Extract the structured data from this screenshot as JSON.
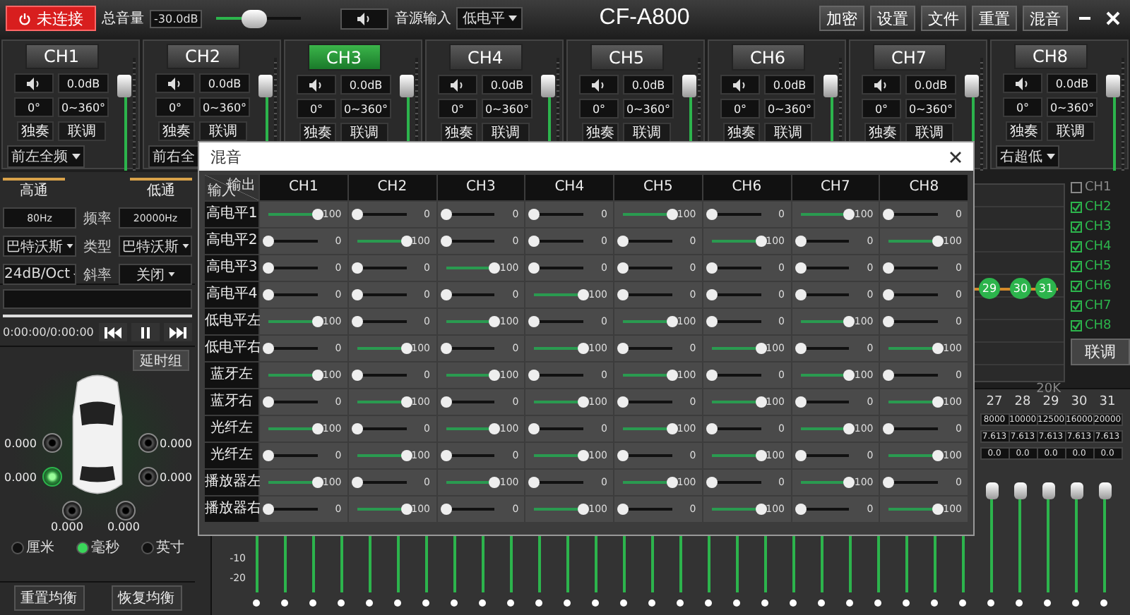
{
  "title_bar": {
    "connect_button": "未连接",
    "volume_label": "总音量",
    "volume_reading": "-30.0dB",
    "volume": {
      "level": 0.45
    },
    "source_label": "音源输入",
    "source_select": "低电平",
    "title": "CF-A800",
    "buttons": [
      "加密",
      "设置",
      "文件",
      "重置",
      "混音"
    ]
  },
  "channels": [
    {
      "name": "CH1",
      "selected": false,
      "gain": "0.0dB",
      "phase": "0°",
      "phase_range": "0~360°",
      "solo": "独奏",
      "link": "联调",
      "output": "前左全频",
      "caret": true,
      "level": 0.85
    },
    {
      "name": "CH2",
      "selected": false,
      "gain": "0.0dB",
      "phase": "0°",
      "phase_range": "0~360°",
      "solo": "独奏",
      "link": "联调",
      "output": "前右全",
      "caret": false,
      "level": 0.85
    },
    {
      "name": "CH3",
      "selected": true,
      "gain": "0.0dB",
      "phase": "0°",
      "phase_range": "0~360°",
      "solo": "独奏",
      "link": "联调",
      "level": 0.85
    },
    {
      "name": "CH4",
      "selected": false,
      "gain": "0.0dB",
      "phase": "0°",
      "phase_range": "0~360°",
      "solo": "独奏",
      "link": "联调",
      "level": 0.85
    },
    {
      "name": "CH5",
      "selected": false,
      "gain": "0.0dB",
      "phase": "0°",
      "phase_range": "0~360°",
      "solo": "独奏",
      "link": "联调",
      "level": 0.85
    },
    {
      "name": "CH6",
      "selected": false,
      "gain": "0.0dB",
      "phase": "0°",
      "phase_range": "0~360°",
      "solo": "独奏",
      "link": "联调",
      "level": 0.85
    },
    {
      "name": "CH7",
      "selected": false,
      "gain": "0.0dB",
      "phase": "0°",
      "phase_range": "0~360°",
      "solo": "独奏",
      "link": "联调",
      "level": 0.85
    },
    {
      "name": "CH8",
      "selected": false,
      "gain": "0.0dB",
      "phase": "0°",
      "phase_range": "0~360°",
      "solo": "独奏",
      "link": "联调",
      "output": "右超低",
      "caret": true,
      "level": 0.85
    }
  ],
  "filter": {
    "highpass_label": "高通",
    "lowpass_label": "低通",
    "rows": [
      {
        "kind": "value",
        "label": "频率",
        "highpass": "80Hz",
        "lowpass": "20000Hz"
      },
      {
        "kind": "select",
        "label": "类型",
        "highpass": "巴特沃斯",
        "lowpass": "巴特沃斯"
      },
      {
        "kind": "select",
        "label": "斜率",
        "highpass": "24dB/Oct",
        "lowpass": "关闭"
      }
    ]
  },
  "player": {
    "time": "0:00:00/0:00:00"
  },
  "delay": {
    "group_button": "延时组",
    "speakers": [
      {
        "value": "0.000",
        "selected": false
      },
      {
        "value": "0.000",
        "selected": false
      },
      {
        "value": "0.000",
        "selected": true
      },
      {
        "value": "0.000",
        "selected": false
      },
      {
        "value": "0.000",
        "selected": false
      },
      {
        "value": "0.000",
        "selected": false
      }
    ],
    "units": [
      {
        "label": "厘米",
        "selected": false
      },
      {
        "label": "毫秒",
        "selected": true
      },
      {
        "label": "英寸",
        "selected": false
      }
    ]
  },
  "eq_buttons": [
    "重置均衡",
    "恢复均衡"
  ],
  "eq": {
    "nodes": [
      "29",
      "30",
      "31"
    ],
    "axis_label": "20K",
    "channel_checks": [
      {
        "label": "CH1",
        "checked": false
      },
      {
        "label": "CH2",
        "checked": true
      },
      {
        "label": "CH3",
        "checked": true
      },
      {
        "label": "CH4",
        "checked": true
      },
      {
        "label": "CH5",
        "checked": true
      },
      {
        "label": "CH6",
        "checked": true
      },
      {
        "label": "CH7",
        "checked": true
      },
      {
        "label": "CH8",
        "checked": true
      }
    ],
    "link_button": "联调",
    "scale": [
      "-10",
      "-20"
    ],
    "bands": [
      {
        "number": "27",
        "freq": "8000",
        "q": "7.613",
        "gain": "0.0"
      },
      {
        "number": "28",
        "freq": "10000",
        "q": "7.613",
        "gain": "0.0"
      },
      {
        "number": "29",
        "freq": "12500",
        "q": "7.613",
        "gain": "0.0"
      },
      {
        "number": "30",
        "freq": "16000",
        "q": "7.613",
        "gain": "0.0"
      },
      {
        "number": "31",
        "freq": "20000",
        "q": "7.613",
        "gain": "0.0"
      }
    ]
  },
  "mixer": {
    "title": "混音",
    "input_label": "输入",
    "output_label": "输出",
    "columns": [
      "CH1",
      "CH2",
      "CH3",
      "CH4",
      "CH5",
      "CH6",
      "CH7",
      "CH8"
    ],
    "rows": [
      {
        "label": "高电平1",
        "cells": [
          {
            "level": 1,
            "value": "100"
          },
          {
            "level": 0,
            "value": "0"
          },
          {
            "level": 0,
            "value": "0"
          },
          {
            "level": 0,
            "value": "0"
          },
          {
            "level": 1,
            "value": "100"
          },
          {
            "level": 0,
            "value": "0"
          },
          {
            "level": 1,
            "value": "100"
          },
          {
            "level": 0,
            "value": "0"
          }
        ]
      },
      {
        "label": "高电平2",
        "cells": [
          {
            "level": 0,
            "value": "0"
          },
          {
            "level": 1,
            "value": "100"
          },
          {
            "level": 0,
            "value": "0"
          },
          {
            "level": 0,
            "value": "0"
          },
          {
            "level": 0,
            "value": "0"
          },
          {
            "level": 1,
            "value": "100"
          },
          {
            "level": 0,
            "value": "0"
          },
          {
            "level": 1,
            "value": "100"
          }
        ]
      },
      {
        "label": "高电平3",
        "cells": [
          {
            "level": 0,
            "value": "0"
          },
          {
            "level": 0,
            "value": "0"
          },
          {
            "level": 1,
            "value": "100"
          },
          {
            "level": 0,
            "value": "0"
          },
          {
            "level": 0,
            "value": "0"
          },
          {
            "level": 0,
            "value": "0"
          },
          {
            "level": 0,
            "value": "0"
          },
          {
            "level": 0,
            "value": "0"
          }
        ]
      },
      {
        "label": "高电平4",
        "cells": [
          {
            "level": 0,
            "value": "0"
          },
          {
            "level": 0,
            "value": "0"
          },
          {
            "level": 0,
            "value": "0"
          },
          {
            "level": 1,
            "value": "100"
          },
          {
            "level": 0,
            "value": "0"
          },
          {
            "level": 0,
            "value": "0"
          },
          {
            "level": 0,
            "value": "0"
          },
          {
            "level": 0,
            "value": "0"
          }
        ]
      },
      {
        "label": "低电平左",
        "cells": [
          {
            "level": 1,
            "value": "100"
          },
          {
            "level": 0,
            "value": "0"
          },
          {
            "level": 1,
            "value": "100"
          },
          {
            "level": 0,
            "value": "0"
          },
          {
            "level": 1,
            "value": "100"
          },
          {
            "level": 0,
            "value": "0"
          },
          {
            "level": 1,
            "value": "100"
          },
          {
            "level": 0,
            "value": "0"
          }
        ]
      },
      {
        "label": "低电平右",
        "cells": [
          {
            "level": 0,
            "value": "0"
          },
          {
            "level": 1,
            "value": "100"
          },
          {
            "level": 0,
            "value": "0"
          },
          {
            "level": 1,
            "value": "100"
          },
          {
            "level": 0,
            "value": "0"
          },
          {
            "level": 1,
            "value": "100"
          },
          {
            "level": 0,
            "value": "0"
          },
          {
            "level": 1,
            "value": "100"
          }
        ]
      },
      {
        "label": "蓝牙左",
        "cells": [
          {
            "level": 1,
            "value": "100"
          },
          {
            "level": 0,
            "value": "0"
          },
          {
            "level": 1,
            "value": "100"
          },
          {
            "level": 0,
            "value": "0"
          },
          {
            "level": 1,
            "value": "100"
          },
          {
            "level": 0,
            "value": "0"
          },
          {
            "level": 1,
            "value": "100"
          },
          {
            "level": 0,
            "value": "0"
          }
        ]
      },
      {
        "label": "蓝牙右",
        "cells": [
          {
            "level": 0,
            "value": "0"
          },
          {
            "level": 1,
            "value": "100"
          },
          {
            "level": 0,
            "value": "0"
          },
          {
            "level": 1,
            "value": "100"
          },
          {
            "level": 0,
            "value": "0"
          },
          {
            "level": 1,
            "value": "100"
          },
          {
            "level": 0,
            "value": "0"
          },
          {
            "level": 1,
            "value": "100"
          }
        ]
      },
      {
        "label": "光纤左",
        "cells": [
          {
            "level": 1,
            "value": "100"
          },
          {
            "level": 0,
            "value": "0"
          },
          {
            "level": 1,
            "value": "100"
          },
          {
            "level": 0,
            "value": "0"
          },
          {
            "level": 1,
            "value": "100"
          },
          {
            "level": 0,
            "value": "0"
          },
          {
            "level": 1,
            "value": "100"
          },
          {
            "level": 0,
            "value": "0"
          }
        ]
      },
      {
        "label": "光纤左",
        "cells": [
          {
            "level": 0,
            "value": "0"
          },
          {
            "level": 1,
            "value": "100"
          },
          {
            "level": 0,
            "value": "0"
          },
          {
            "level": 1,
            "value": "100"
          },
          {
            "level": 0,
            "value": "0"
          },
          {
            "level": 1,
            "value": "100"
          },
          {
            "level": 0,
            "value": "0"
          },
          {
            "level": 1,
            "value": "100"
          }
        ]
      },
      {
        "label": "播放器左",
        "cells": [
          {
            "level": 1,
            "value": "100"
          },
          {
            "level": 0,
            "value": "0"
          },
          {
            "level": 1,
            "value": "100"
          },
          {
            "level": 0,
            "value": "0"
          },
          {
            "level": 1,
            "value": "100"
          },
          {
            "level": 0,
            "value": "0"
          },
          {
            "level": 1,
            "value": "100"
          },
          {
            "level": 0,
            "value": "0"
          }
        ]
      },
      {
        "label": "播放器右",
        "cells": [
          {
            "level": 0,
            "value": "0"
          },
          {
            "level": 1,
            "value": "100"
          },
          {
            "level": 0,
            "value": "0"
          },
          {
            "level": 1,
            "value": "100"
          },
          {
            "level": 0,
            "value": "0"
          },
          {
            "level": 1,
            "value": "100"
          },
          {
            "level": 0,
            "value": "0"
          },
          {
            "level": 1,
            "value": "100"
          }
        ]
      }
    ]
  }
}
